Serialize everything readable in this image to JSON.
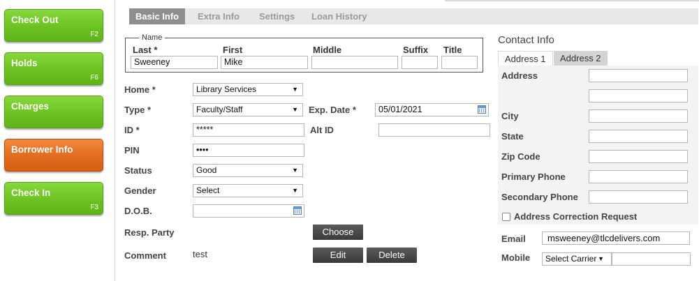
{
  "sidebar": {
    "buttons": [
      {
        "label": "Check Out",
        "key": "F2"
      },
      {
        "label": "Holds",
        "key": "F6"
      },
      {
        "label": "Charges",
        "key": ""
      },
      {
        "label": "Borrower Info",
        "key": ""
      },
      {
        "label": "Check In",
        "key": "F3"
      }
    ]
  },
  "tabs": [
    "Basic Info",
    "Extra Info",
    "Settings",
    "Loan History"
  ],
  "name": {
    "legend": "Name",
    "last_label": "Last *",
    "last_value": "Sweeney",
    "first_label": "First",
    "first_value": "Mike",
    "middle_label": "Middle",
    "middle_value": "",
    "suffix_label": "Suffix",
    "suffix_value": "",
    "title_label": "Title",
    "title_value": ""
  },
  "form": {
    "home_label": "Home *",
    "home_value": "Library Services",
    "type_label": "Type *",
    "type_value": "Faculty/Staff",
    "exp_label": "Exp. Date *",
    "exp_value": "05/01/2021",
    "id_label": "ID *",
    "id_value": "*****",
    "altid_label": "Alt ID",
    "altid_value": "",
    "pin_label": "PIN",
    "pin_value": "••••",
    "status_label": "Status",
    "status_value": "Good",
    "gender_label": "Gender",
    "gender_value": "Select",
    "dob_label": "D.O.B.",
    "dob_value": "",
    "resp_label": "Resp. Party",
    "choose_label": "Choose",
    "comment_label": "Comment",
    "comment_value": "test",
    "edit_label": "Edit",
    "delete_label": "Delete"
  },
  "contact": {
    "title": "Contact Info",
    "tab1": "Address 1",
    "tab2": "Address 2",
    "address_label": "Address",
    "city_label": "City",
    "state_label": "State",
    "zip_label": "Zip Code",
    "primary_label": "Primary Phone",
    "secondary_label": "Secondary Phone",
    "correction_label": "Address Correction Request",
    "email_label": "Email",
    "email_value": "msweeney@tlcdelivers.com",
    "mobile_label": "Mobile",
    "carrier_value": "Select Carrier"
  },
  "colors": {
    "green": "#6cc221",
    "orange": "#e26b1c",
    "tab_active": "#8e8e8e"
  }
}
